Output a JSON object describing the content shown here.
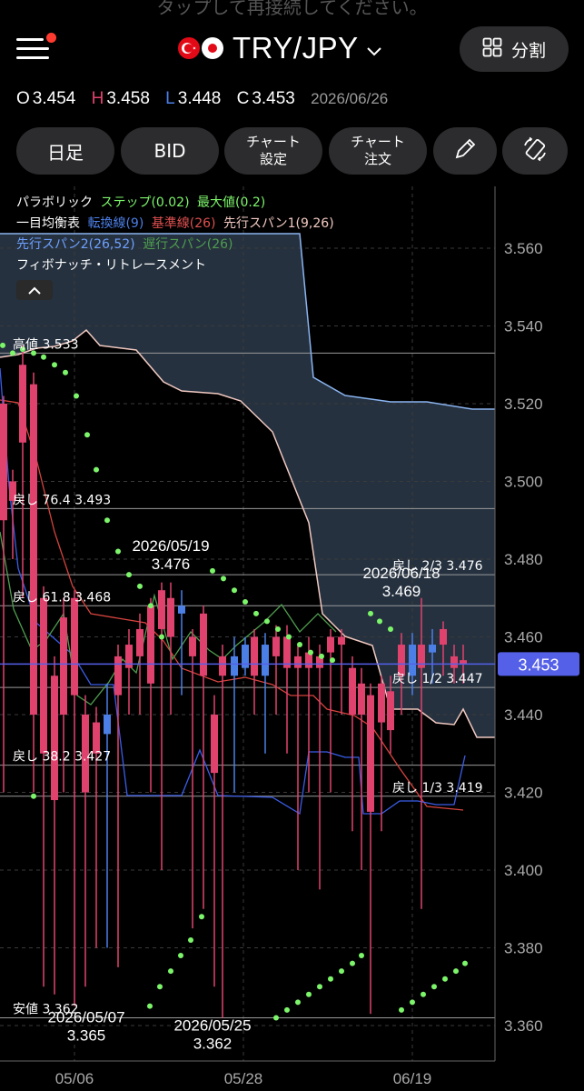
{
  "banner_text": "タップして再接続してください。",
  "header": {
    "pair": "TRY/JPY",
    "split_label": "分割"
  },
  "ohlc": {
    "o_key": "O",
    "o": "3.454",
    "h_key": "H",
    "h": "3.458",
    "l_key": "L",
    "l": "3.448",
    "c_key": "C",
    "c": "3.453",
    "date": "2026/06/26"
  },
  "toolbar": {
    "timeframe": "日足",
    "bid": "BID",
    "chart_settings_1": "チャート",
    "chart_settings_2": "設定",
    "chart_order_1": "チャート",
    "chart_order_2": "注文"
  },
  "legend": {
    "psar": "パラボリック",
    "psar_step": "ステップ(0.02)",
    "psar_max": "最大値(0.2)",
    "ichimoku": "一目均衡表",
    "tenkan": "転換線(9)",
    "kijun": "基準線(26)",
    "span1": "先行スパン1(9,26)",
    "span2": "先行スパン2(26,52)",
    "chikou": "遅行スパン(26)",
    "fib": "フィボナッチ・リトレースメント"
  },
  "colors": {
    "up": "#4c7fe6",
    "down": "#e0426e",
    "tenkan": "#3a5de8",
    "kijun": "#d6443e",
    "chikou": "#4f9d4f",
    "psar": "#7cf56a",
    "cloud": "#2c3a4a",
    "span1": "#f0c8c0",
    "span2": "#8ab4f0",
    "price_label_bg": "#5560e8"
  },
  "chart_data": {
    "type": "candlestick",
    "y_ticks": [
      "3.560",
      "3.540",
      "3.520",
      "3.500",
      "3.480",
      "3.460",
      "3.440",
      "3.420",
      "3.400",
      "3.380",
      "3.360"
    ],
    "x_ticks": [
      "05/06",
      "05/28",
      "06/19"
    ],
    "current_price": "3.453",
    "fib_levels": [
      {
        "label": "高値 3.533",
        "value": 3.533
      },
      {
        "label": "戻し 76.4 3.493",
        "value": 3.493
      },
      {
        "label": "戻し 2/3 3.476",
        "value": 3.476
      },
      {
        "label": "戻し 61.8 3.468",
        "value": 3.468
      },
      {
        "label": "戻し 1/2 3.447",
        "value": 3.447
      },
      {
        "label": "戻し 38.2 3.427",
        "value": 3.427
      },
      {
        "label": "戻し 1/3 3.419",
        "value": 3.419
      },
      {
        "label": "安値 3.362",
        "value": 3.362
      }
    ],
    "annotations": [
      {
        "date": "2026/05/19",
        "value": "3.476"
      },
      {
        "date": "2026/06/18",
        "value": "3.469"
      },
      {
        "date": "2026/05/07",
        "value": "3.365"
      },
      {
        "date": "2026/05/25",
        "value": "3.362"
      }
    ]
  }
}
